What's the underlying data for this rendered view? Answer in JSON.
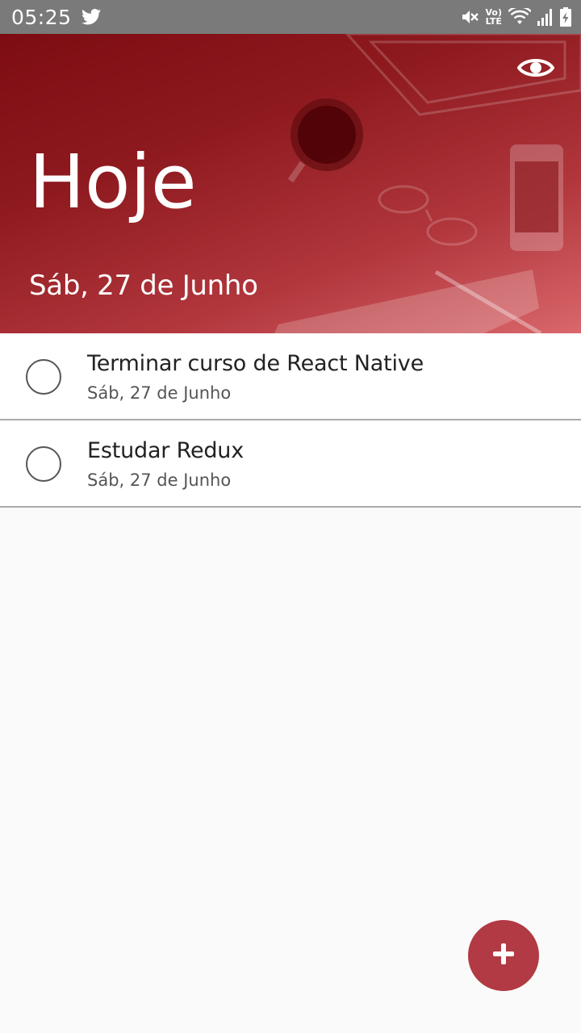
{
  "status_bar": {
    "time": "05:25",
    "left_icons": [
      "twitter-icon"
    ],
    "right_icons": [
      "mute-icon",
      "volte-icon",
      "wifi-icon",
      "signal-icon",
      "battery-charging-icon"
    ],
    "volte_top": "Vo)",
    "volte_bottom": "LTE"
  },
  "header": {
    "title": "Hoje",
    "date": "Sáb, 27 de Junho",
    "toggle_icon": "eye-icon",
    "accent_color": "#8e1a1f"
  },
  "tasks": [
    {
      "title": "Terminar curso de React Native",
      "date": "Sáb, 27 de Junho",
      "done": false
    },
    {
      "title": "Estudar Redux",
      "date": "Sáb, 27 de Junho",
      "done": false
    }
  ],
  "fab": {
    "icon": "plus-icon",
    "color": "#b13a44"
  }
}
